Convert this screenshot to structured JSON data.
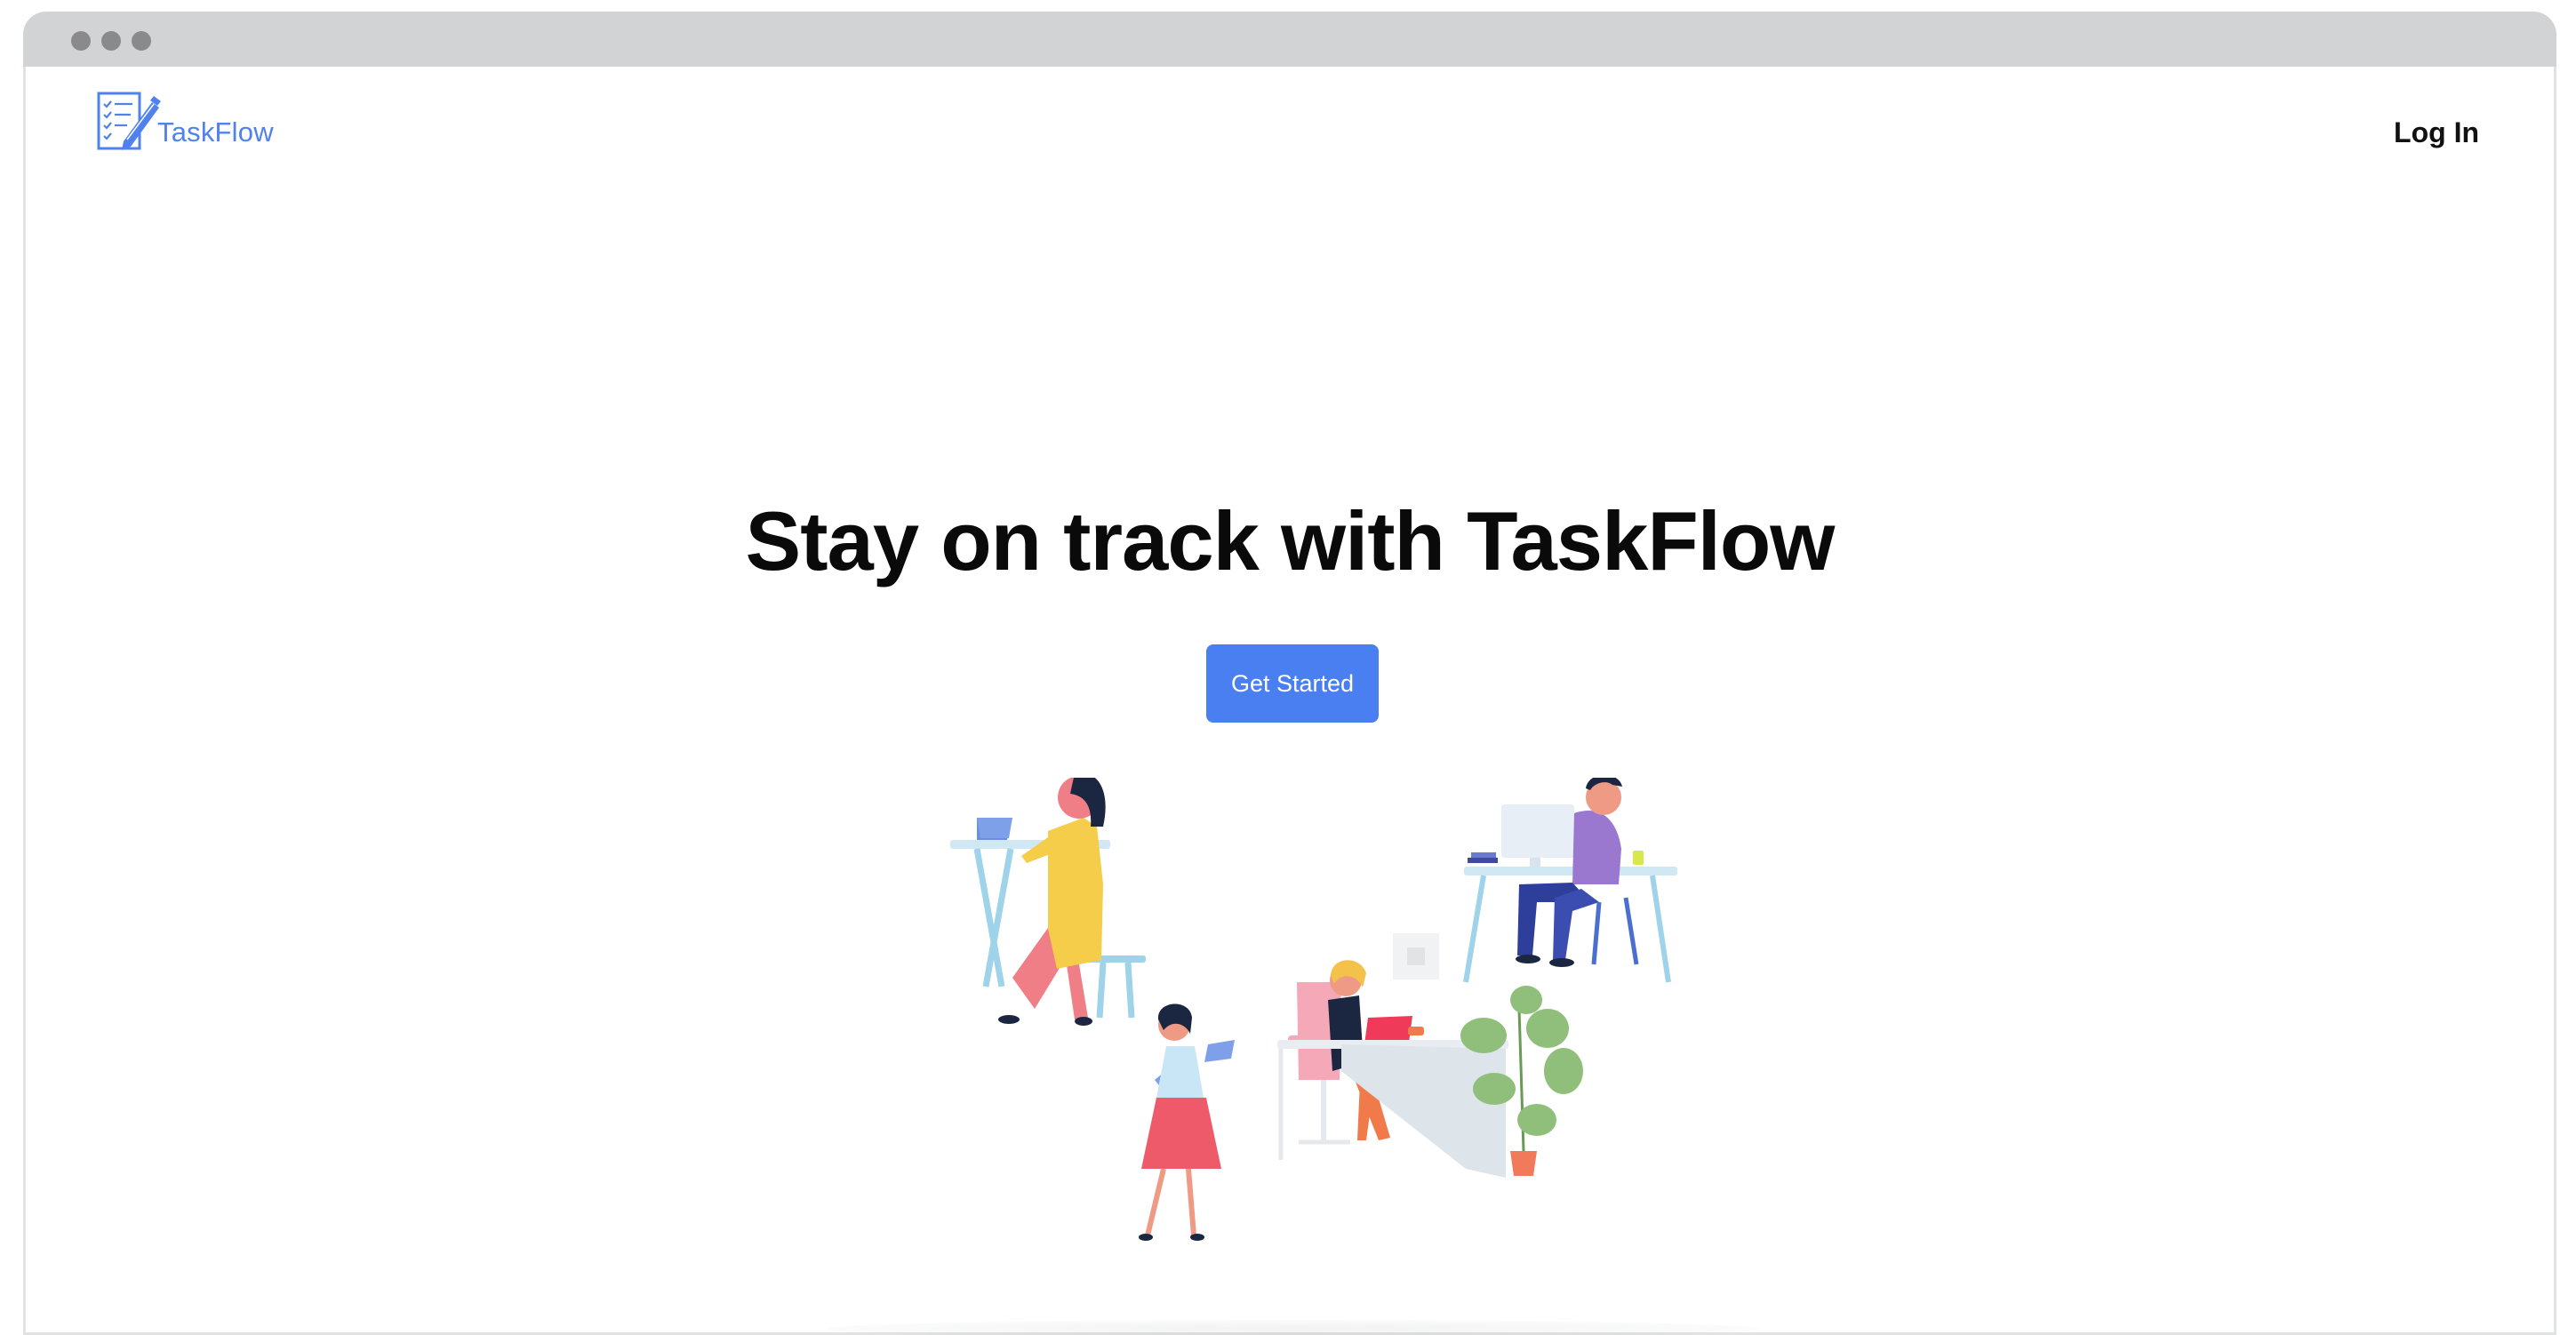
{
  "browser": {
    "window_controls": [
      "close-dot",
      "minimize-dot",
      "maximize-dot"
    ]
  },
  "navbar": {
    "logo_text": "TaskFlow",
    "logo_icon": "checklist-pen-icon",
    "login_label": "Log In"
  },
  "hero": {
    "title": "Stay on track with TaskFlow",
    "cta_label": "Get Started",
    "illustration": "office-workers-illustration"
  },
  "colors": {
    "brand_blue": "#4a7ff1",
    "logo_blue": "#4f82ee",
    "title_text": "#0a0a0a",
    "chrome_gray": "#d2d3d5"
  }
}
